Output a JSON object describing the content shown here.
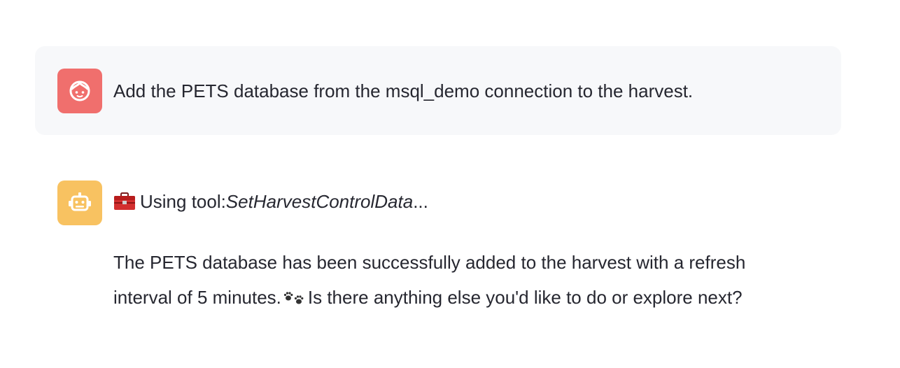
{
  "chat": {
    "messages": [
      {
        "role": "user",
        "avatar_icon": "user-face-icon",
        "avatar_color": "#f06f6d",
        "text": "Add the PETS database from the msql_demo connection to the harvest."
      },
      {
        "role": "assistant",
        "avatar_icon": "robot-icon",
        "avatar_color": "#f8c261",
        "tool_prefix": "Using tool: ",
        "tool_name": "SetHarvestControlData",
        "tool_suffix": "...",
        "tool_icon": "toolbox-icon",
        "reply_line_1": "The PETS database has been successfully added to the harvest with a refresh",
        "reply_line_2a": "interval of 5 minutes.",
        "reply_emoji": "paw-prints-icon",
        "reply_line_2b": "Is there anything else you'd like to do or explore next?"
      }
    ]
  },
  "colors": {
    "user_message_bg": "#f7f8fa",
    "text": "#262730"
  }
}
